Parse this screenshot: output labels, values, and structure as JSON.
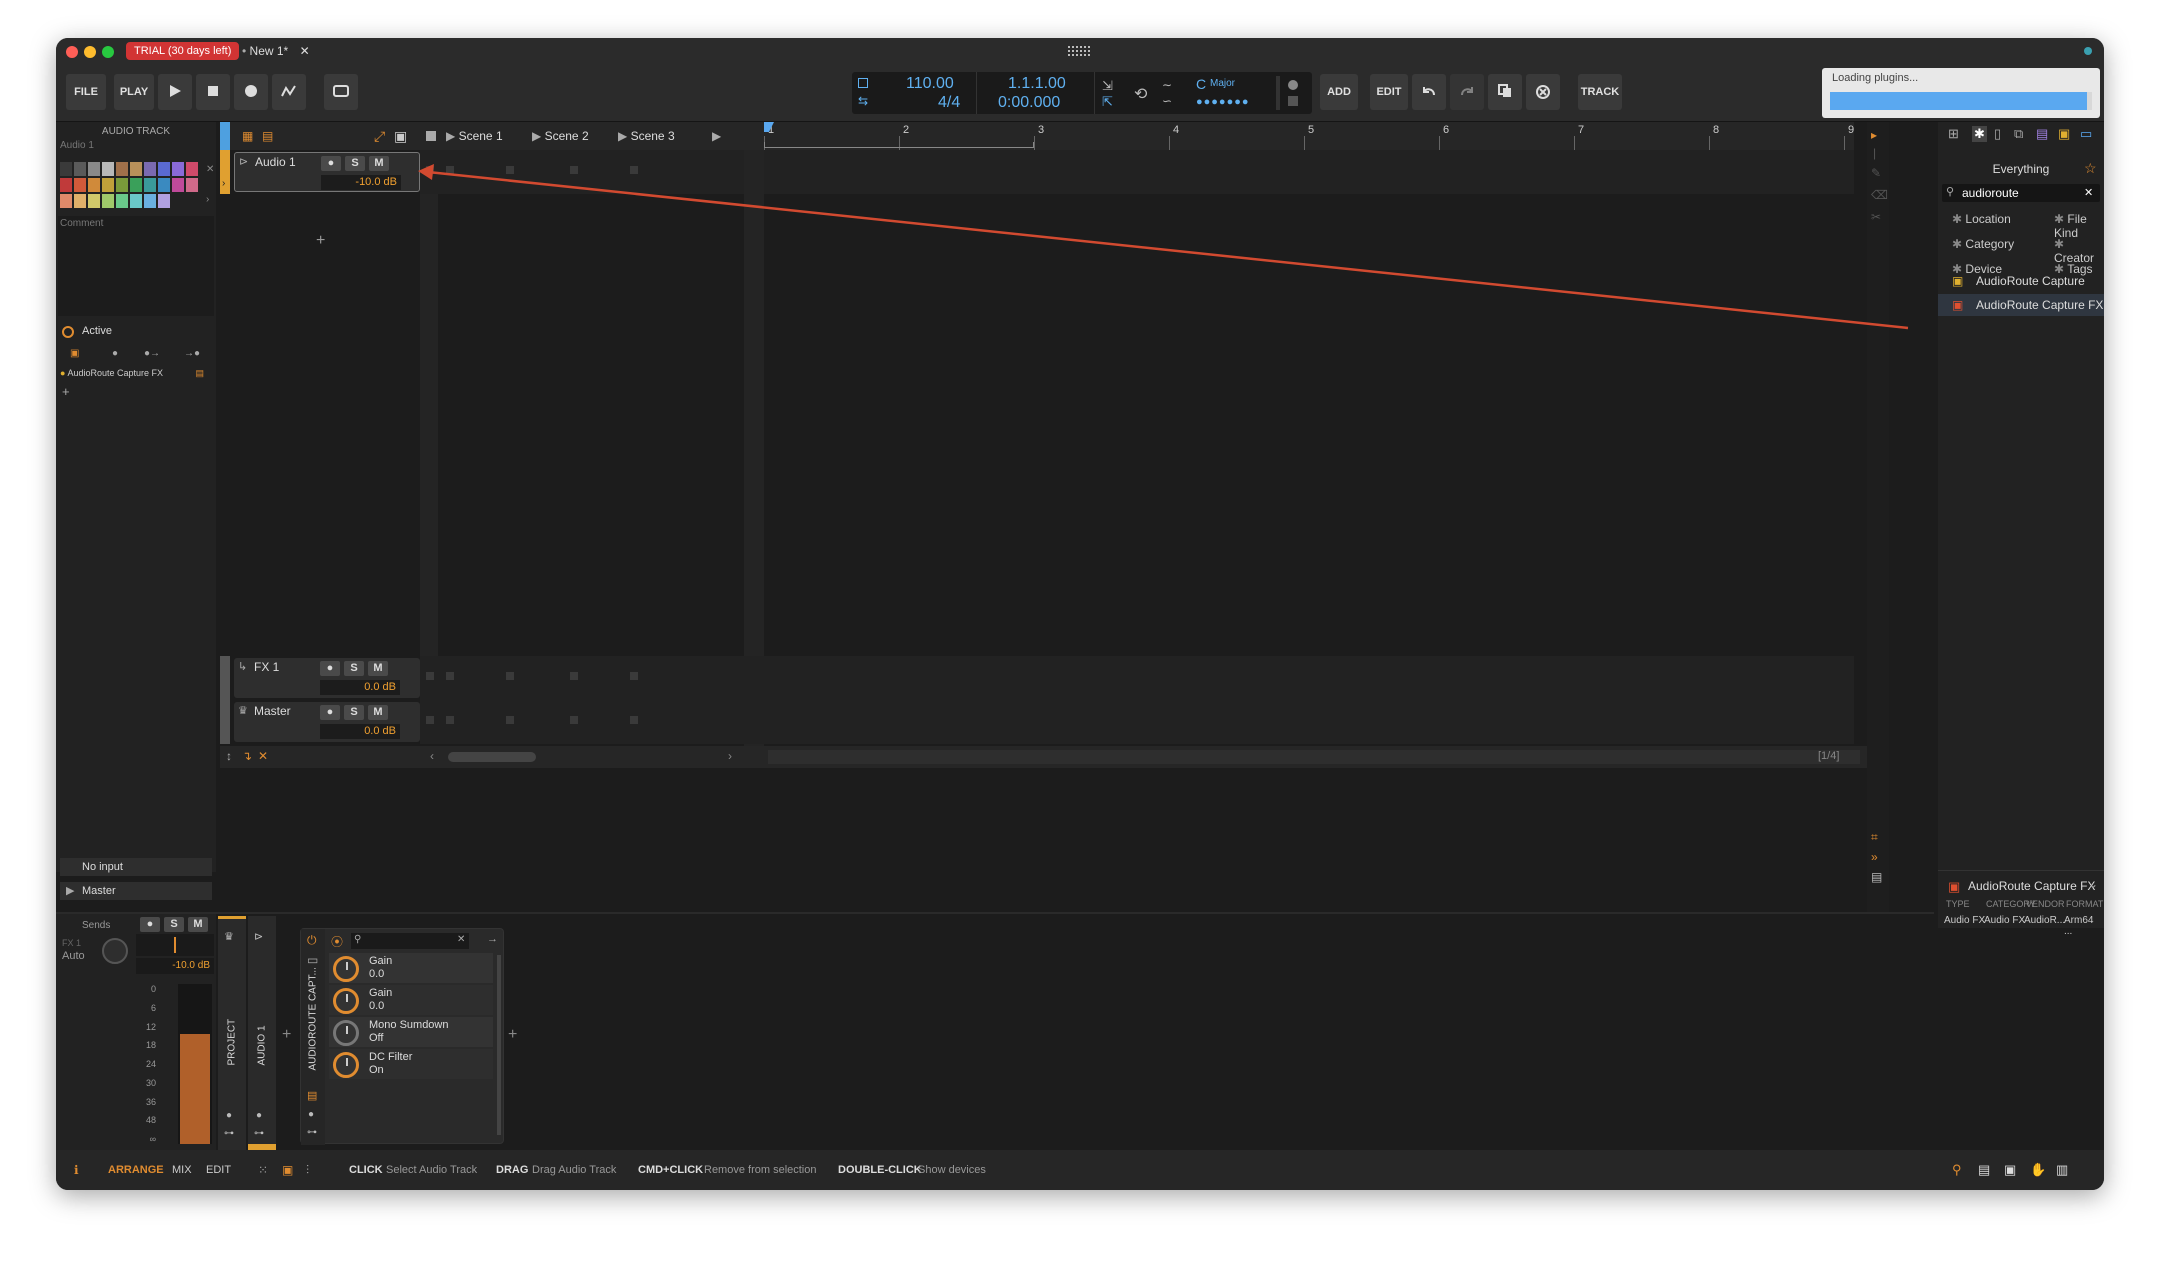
{
  "window": {
    "trial_badge": "TRIAL (30 days left)",
    "doc_tab": "New 1*",
    "doc_close": "✕"
  },
  "toolbar": {
    "file": "FILE",
    "play_label": "PLAY",
    "add": "ADD",
    "edit": "EDIT",
    "track": "TRACK",
    "tempo": "110.00",
    "time_sig": "4/4",
    "position_bars": "1.1.1.00",
    "position_time": "0:00.000",
    "key": "C",
    "scale": "Major"
  },
  "loading": {
    "text": "Loading plugins...",
    "progress": 0.98
  },
  "inspector": {
    "header": "AUDIO TRACK",
    "track_name": "Audio 1",
    "comment_label": "Comment",
    "active_label": "Active",
    "device": "AudioRoute Capture FX",
    "add": "+",
    "input": "No input",
    "output": "Master",
    "swatches": [
      "#3a3a3a",
      "#5a5a5a",
      "#8a8a8a",
      "#b8b8b8",
      "#a0704a",
      "#b8905a",
      "#7a6ab0",
      "#5a6ad0",
      "#8a6ad8",
      "#d04a6a",
      "#c03a3a",
      "#d05a3a",
      "#d08a3a",
      "#c0a03a",
      "#7a9a3a",
      "#3aa05a",
      "#3a9a9a",
      "#3a8ac0",
      "#c04a9a",
      "#d06a8a",
      "#e08a6a",
      "#e0b06a",
      "#d0c86a",
      "#a0c86a",
      "#6ac88a",
      "#6ac8c8",
      "#6ab0e0",
      "#b0a0e0"
    ]
  },
  "arranger": {
    "scenes": [
      "Scene 1",
      "Scene 2",
      "Scene 3"
    ],
    "ruler": [
      "1",
      "2",
      "3",
      "4",
      "5",
      "6",
      "7",
      "8",
      "9"
    ],
    "tracks": [
      {
        "name": "Audio 1",
        "volume": "-10.0 dB"
      },
      {
        "name": "FX 1",
        "volume": "0.0 dB"
      },
      {
        "name": "Master",
        "volume": "0.0 dB"
      }
    ],
    "add_track": "+",
    "page_indicator": "[1/4]",
    "s": "S",
    "m": "M"
  },
  "browser": {
    "category": "Everything",
    "search": "audioroute",
    "filters": [
      "Location",
      "File Kind",
      "Category",
      "Creator",
      "Device",
      "Tags"
    ],
    "results": [
      "AudioRoute Capture",
      "AudioRoute Capture FX"
    ],
    "selected_title": "AudioRoute Capture FX",
    "info_headers": [
      "TYPE",
      "CATEGORY",
      "VENDOR",
      "FORMAT"
    ],
    "info_values": [
      "Audio FX",
      "Audio FX",
      "AudioR...",
      "Arm64 ..."
    ]
  },
  "mixer": {
    "sends": "Sends",
    "fx_send": "FX 1",
    "auto": "Auto",
    "volume": "-10.0 dB",
    "meter_scale": [
      "0",
      "6",
      "12",
      "18",
      "24",
      "30",
      "36",
      "48",
      "∞"
    ],
    "project_label": "PROJECT",
    "track_label": "AUDIO 1",
    "device_tab": "AUDIOROUTE CAPT...",
    "device_params": [
      {
        "name": "Gain",
        "value": "0.0"
      },
      {
        "name": "Gain",
        "value": "0.0"
      },
      {
        "name": "Mono Sumdown",
        "value": "Off"
      },
      {
        "name": "DC Filter",
        "value": "On"
      }
    ]
  },
  "status": {
    "modes": [
      "ARRANGE",
      "MIX",
      "EDIT"
    ],
    "hints": [
      {
        "key": "CLICK",
        "desc": "Select Audio Track"
      },
      {
        "key": "DRAG",
        "desc": "Drag Audio Track"
      },
      {
        "key": "CMD+CLICK",
        "desc": "Remove from selection"
      },
      {
        "key": "DOUBLE-CLICK",
        "desc": "Show devices"
      }
    ]
  }
}
